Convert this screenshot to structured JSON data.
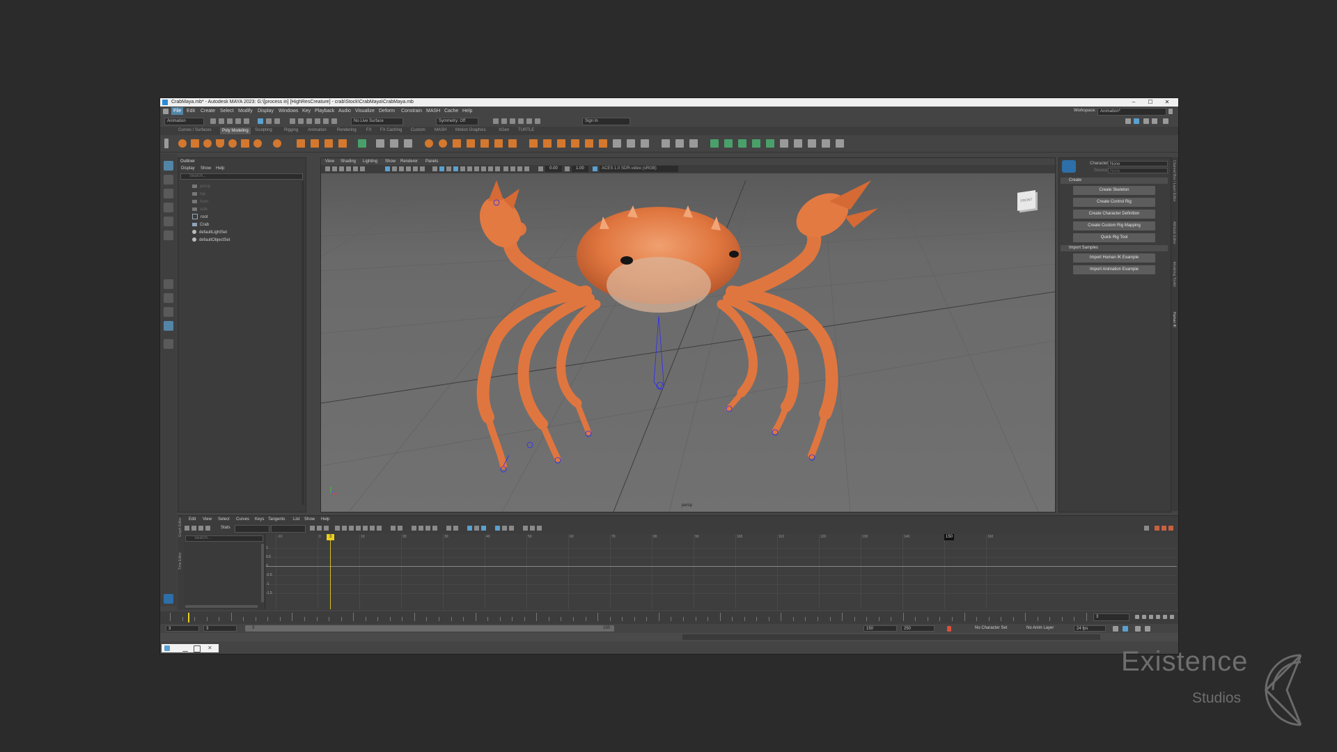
{
  "window": {
    "title": "CrabMaya.mb* - Autodesk MAYA 2023: G:\\[process in] [HighResCreature] - crab\\Stock\\CrabMaya\\CrabMaya.mb",
    "controls": [
      "–",
      "☐",
      "✕"
    ]
  },
  "menubar": {
    "items": [
      "File",
      "Edit",
      "Create",
      "Select",
      "Modify",
      "Display",
      "Windows",
      "Key",
      "Playback",
      "Audio",
      "Visualize",
      "Deform",
      "Constrain",
      "MASH",
      "Cache",
      "Help"
    ],
    "workspace_label": "Workspace:",
    "workspace_value": "Animation*"
  },
  "statusline": {
    "mode": "Animation",
    "live_surface": "No Live Surface",
    "symmetry": "Symmetry: Off",
    "sign_in": "Sign In"
  },
  "shelf": {
    "tabs": [
      "Curves / Surfaces",
      "Poly Modeling",
      "Sculpting",
      "Rigging",
      "Animation",
      "Rendering",
      "FX",
      "FX Caching",
      "Custom",
      "MASH",
      "Motion Graphics",
      "XGen",
      "TURTLE"
    ],
    "active_tab": "Poly Modeling"
  },
  "outliner": {
    "title": "Outliner",
    "menu": [
      "Display",
      "Show",
      "Help"
    ],
    "search_placeholder": "Search...",
    "items": [
      {
        "label": "persp",
        "dim": true
      },
      {
        "label": "top",
        "dim": true
      },
      {
        "label": "front",
        "dim": true
      },
      {
        "label": "side",
        "dim": true
      },
      {
        "label": "root",
        "dim": false
      },
      {
        "label": "Crab",
        "dim": false
      },
      {
        "label": "defaultLightSet",
        "dim": false
      },
      {
        "label": "defaultObjectSet",
        "dim": false
      }
    ]
  },
  "viewport": {
    "menu": [
      "View",
      "Shading",
      "Lighting",
      "Show",
      "Renderer",
      "Panels"
    ],
    "exposure": "0.00",
    "gamma": "1.00",
    "color_management": "ACES 1.0 SDR-video (sRGB)",
    "camera_label": "persp",
    "viewcube_label": "FRONT",
    "bg_color": "#6a6a6a",
    "crab_color": "#e0763f"
  },
  "hik": {
    "character_label": "Character:",
    "character_value": "None",
    "source_label": "Source:",
    "source_value": "None",
    "sections": [
      {
        "title": "Create",
        "buttons": [
          "Create Skeleton",
          "Create Control Rig",
          "Create Character Definition",
          "Create Custom Rig Mapping",
          "Quick Rig Tool"
        ]
      },
      {
        "title": "Import Samples",
        "buttons": [
          "Import Human IK Example",
          "Import Animation Example"
        ]
      }
    ]
  },
  "side_tabs": [
    "Channel Box / Layer Editor",
    "Attribute Editor",
    "Modeling Toolkit",
    "Human IK"
  ],
  "graph_editor": {
    "side_tab_graph": "Graph Editor",
    "side_tab_time": "Time Editor",
    "menu": [
      "Edit",
      "View",
      "Select",
      "Curves",
      "Keys",
      "Tangents",
      "List",
      "Show",
      "Help"
    ],
    "stats_label": "Stats",
    "search_placeholder": "Search...",
    "x_ticks": [
      "-10",
      "0",
      "10",
      "20",
      "30",
      "40",
      "50",
      "60",
      "70",
      "80",
      "90",
      "100",
      "110",
      "120",
      "130",
      "140",
      "150",
      "160"
    ],
    "y_ticks": [
      "1",
      "0.5",
      "0",
      "-0.5",
      "-1",
      "-1.5"
    ],
    "current_frame": "3",
    "end_marker": "150"
  },
  "timeslider": {
    "current_frame": "3"
  },
  "rangeslider": {
    "start": "3",
    "playback_start": "3",
    "range_inner_start": "3",
    "range_inner_end": "150",
    "playback_end": "150",
    "end": "250",
    "character_set": "No Character Set",
    "anim_layer": "No Anim Layer",
    "fps": "24 fps"
  },
  "watermark": {
    "line1": "Existence",
    "line2": "Studios"
  }
}
